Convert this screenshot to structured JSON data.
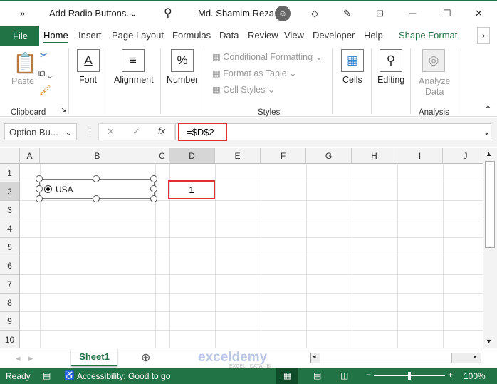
{
  "titlebar": {
    "overflow": "»",
    "doc_title": "Add Radio Buttons...",
    "user": "Md. Shamim Reza"
  },
  "tabs": {
    "file": "File",
    "items": [
      "Home",
      "Insert",
      "Page Layout",
      "Formulas",
      "Data",
      "Review",
      "View",
      "Developer",
      "Help",
      "Shape Format"
    ],
    "active": "Home"
  },
  "ribbon": {
    "paste": "Paste",
    "clipboard": "Clipboard",
    "font": "Font",
    "alignment": "Alignment",
    "number": "Number",
    "conditional": "Conditional Formatting",
    "format_table": "Format as Table",
    "cell_styles": "Cell Styles",
    "styles": "Styles",
    "cells": "Cells",
    "editing": "Editing",
    "analyze1": "Analyze",
    "analyze2": "Data",
    "analysis": "Analysis"
  },
  "formula_bar": {
    "name_box": "Option Bu...",
    "fx": "fx",
    "formula": "=$D$2"
  },
  "grid": {
    "columns": [
      "A",
      "B",
      "C",
      "D",
      "E",
      "F",
      "G",
      "H",
      "I",
      "J"
    ],
    "rows": [
      "1",
      "2",
      "3",
      "4",
      "5",
      "6",
      "7",
      "8",
      "9",
      "10"
    ],
    "radio_label": "USA",
    "d2_value": "1"
  },
  "sheet": {
    "tab": "Sheet1",
    "watermark": "exceldemy",
    "watermark_sub": "EXCEL · DATA · BI"
  },
  "status": {
    "ready": "Ready",
    "accessibility": "Accessibility: Good to go",
    "zoom": "100%"
  },
  "colors": {
    "excel_green": "#217346",
    "highlight": "#e03030"
  }
}
